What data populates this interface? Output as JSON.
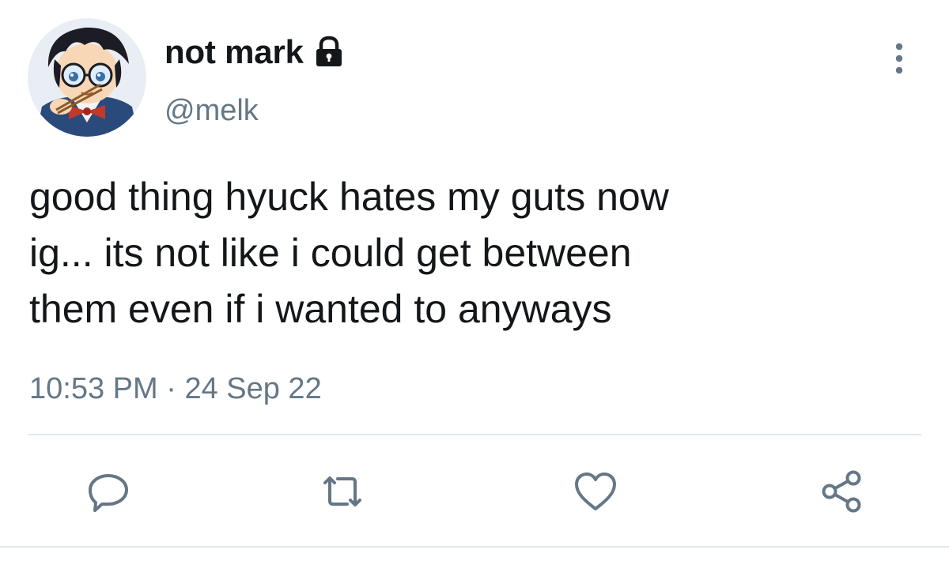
{
  "author": {
    "display_name": "not mark",
    "handle": "@melk",
    "avatar_icon": "anime-character-avatar",
    "protected_icon": "lock-icon"
  },
  "tweet": {
    "text": "good thing hyuck hates my guts now\nig... its not like i could get between\nthem even if i wanted to anyways",
    "time": "10:53 PM",
    "separator": "·",
    "date": "24 Sep 22"
  },
  "actions": [
    {
      "name": "reply",
      "icon": "reply-icon"
    },
    {
      "name": "retweet",
      "icon": "retweet-icon"
    },
    {
      "name": "like",
      "icon": "heart-icon"
    },
    {
      "name": "share",
      "icon": "share-icon"
    }
  ],
  "colors": {
    "text": "#14171a",
    "secondary": "#657786",
    "divider": "#e1e8ed"
  }
}
